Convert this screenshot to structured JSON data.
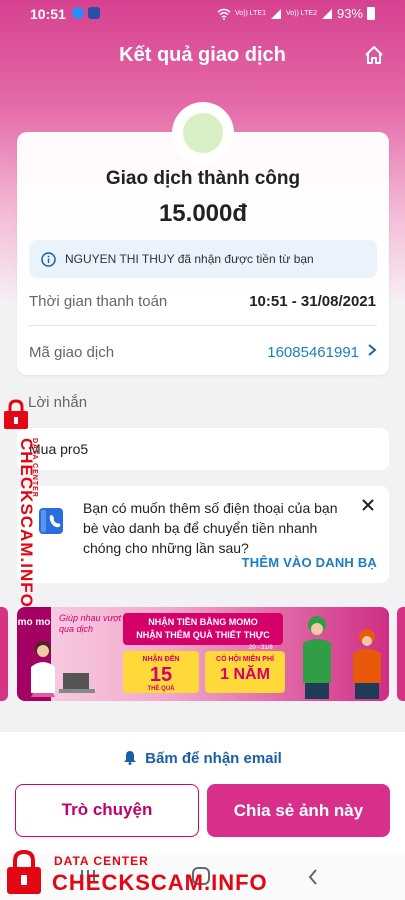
{
  "status_bar": {
    "time": "10:51",
    "network1": "Vo)) LTE1",
    "network2": "Vo)) LTE2",
    "battery": "93%"
  },
  "header": {
    "title": "Kết quả giao dịch",
    "home_icon": "home-icon"
  },
  "transaction": {
    "status": "Giao dịch thành công",
    "amount": "15.000đ",
    "info_message": "NGUYEN THI THUY đã nhận được tiền từ bạn",
    "time_label": "Thời gian thanh toán",
    "time_value": "10:51 - 31/08/2021",
    "id_label": "Mã giao dịch",
    "id_value": "16085461991"
  },
  "message": {
    "label": "Lời nhắn",
    "text": "Mua pro5"
  },
  "contact_prompt": {
    "text": "Bạn có muốn thêm số điện thoại của bạn bè vào danh bạ để chuyển tiền nhanh chóng cho những lần sau?",
    "action": "THÊM VÀO DANH BẠ"
  },
  "banner": {
    "logo": "mo mo",
    "slogan": "Giúp nhau vượt qua dịch",
    "headline_1": "NHẬN TIỀN BẰNG MOMO",
    "headline_2": "NHẬN THÊM QUÀ THIẾT THỰC",
    "badge1_pre": "NHẬN ĐẾN",
    "badge1_num": "15",
    "badge1_post": "THẺ QUÀ",
    "badge2_pre": "CÓ HỘI MIỄN PHÍ",
    "badge2_num": "1 NĂM",
    "date": "20 - 31/8"
  },
  "actions": {
    "email": "Bấm để nhận email",
    "chat": "Trò chuyện",
    "share": "Chia sẻ ảnh này"
  },
  "watermark": {
    "sub": "DATA CENTER",
    "main": "CHECKSCAM.INFO"
  },
  "colors": {
    "brand": "#d6006b",
    "link": "#1a7fc4",
    "watermark": "#e30613"
  }
}
